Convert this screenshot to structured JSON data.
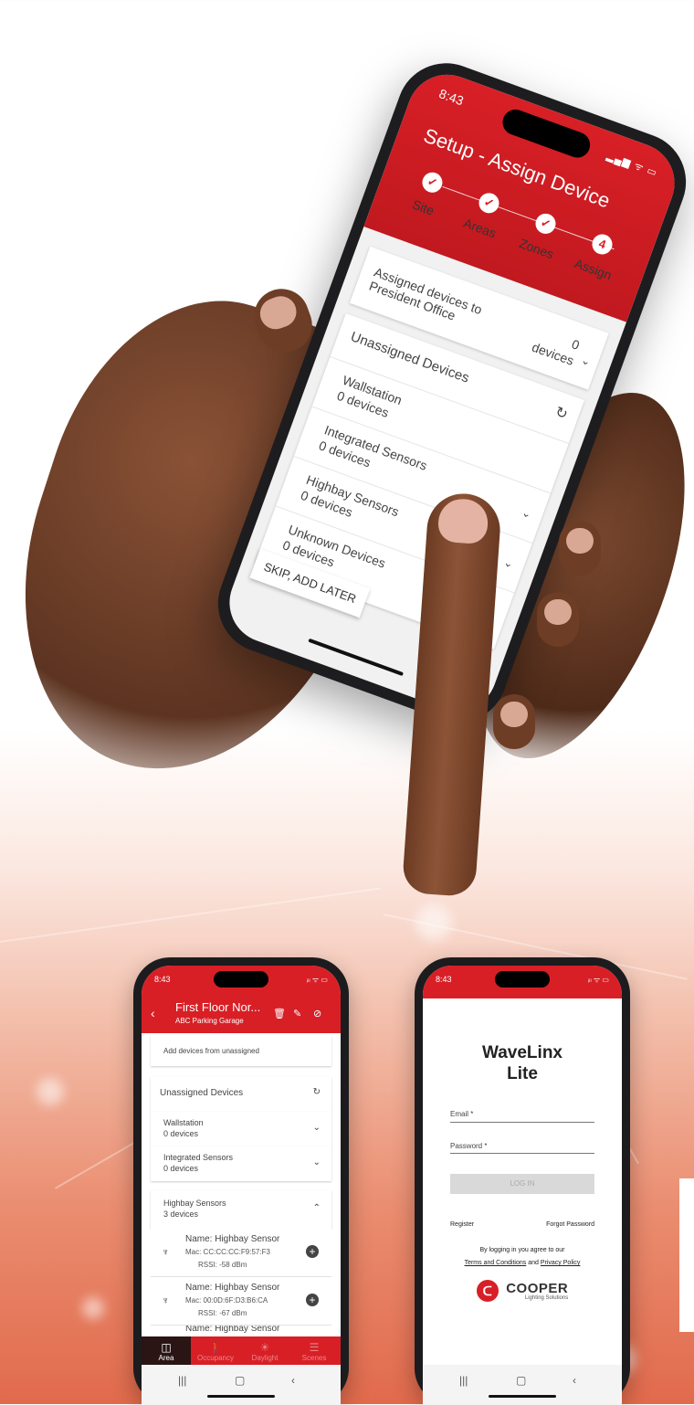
{
  "main_phone": {
    "time": "8:43",
    "status": "▂▄▆ ᯤ ▭",
    "title": "Setup - Assign Device",
    "steps": [
      {
        "label": "Site",
        "mark": "✓"
      },
      {
        "label": "Areas",
        "mark": "✓"
      },
      {
        "label": "Zones",
        "mark": "✓"
      },
      {
        "label": "Assign",
        "mark": "4"
      }
    ],
    "assigned_label": "Assigned devices to President Office",
    "assigned_count": "0",
    "assigned_unit": "devices",
    "unassigned_title": "Unassigned Devices",
    "groups": [
      {
        "name": "Wallstation",
        "count": "0 devices"
      },
      {
        "name": "Integrated Sensors",
        "count": "0 devices"
      },
      {
        "name": "Highbay Sensors",
        "count": "0 devices"
      },
      {
        "name": "Unknown Devices",
        "count": "0 devices"
      }
    ],
    "skip_label": "SKIP, ADD LATER"
  },
  "area_phone": {
    "time": "8:43",
    "status": "ᵢₗₗ ᯤ ▭",
    "title": "First Floor Nor...",
    "subtitle": "ABC Parking Garage",
    "add_devices": "Add devices from unassigned",
    "unassigned_title": "Unassigned Devices",
    "groups": [
      {
        "name": "Wallstation",
        "count": "0 devices"
      },
      {
        "name": "Integrated Sensors",
        "count": "0 devices"
      },
      {
        "name": "Highbay Sensors",
        "count": "3 devices"
      }
    ],
    "devices": [
      {
        "name": "Name: Highbay Sensor",
        "mac": "Mac: CC:CC:CC:F9:57:F3",
        "rssi": "RSSI: -58 dBm"
      },
      {
        "name": "Name: Highbay Sensor",
        "mac": "Mac: 00:0D:6F:D3:B6:CA",
        "rssi": "RSSI: -67 dBm"
      },
      {
        "name": "Name: Highbay Sensor",
        "mac": "",
        "rssi": ""
      }
    ],
    "tabs": [
      "Area",
      "Occupancy",
      "Daylight",
      "Scenes"
    ]
  },
  "login_phone": {
    "time": "8:43",
    "status": "ᵢₗₗ ᯤ ▭",
    "title_line1": "WaveLinx",
    "title_line2": "Lite",
    "email_label": "Email *",
    "password_label": "Password *",
    "login_button": "LOG IN",
    "register": "Register",
    "forgot": "Forgot Password",
    "agree_text": "By logging in you agree to our",
    "terms": "Terms and Conditions",
    "and": "and",
    "privacy": "Privacy Policy",
    "logo_main": "COOPER",
    "logo_sub": "Lighting Solutions"
  },
  "colors": {
    "brand_red": "#d81f26",
    "background_coral": "#e16a4c"
  }
}
